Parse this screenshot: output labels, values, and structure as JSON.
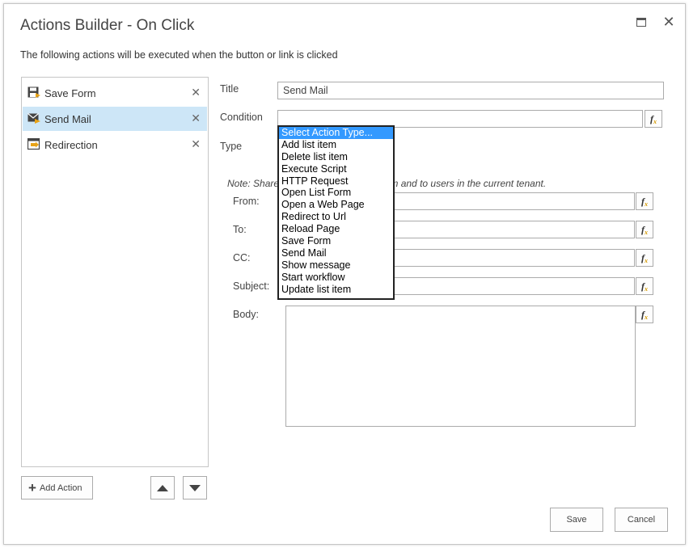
{
  "dialog": {
    "title": "Actions Builder - On Click",
    "subtitle": "The following actions will be executed when the button or link is clicked",
    "close_glyph": "✕"
  },
  "actions": [
    {
      "label": "Save Form",
      "icon": "save-form-icon",
      "selected": false
    },
    {
      "label": "Send Mail",
      "icon": "send-mail-icon",
      "selected": true
    },
    {
      "label": "Redirection",
      "icon": "redirection-icon",
      "selected": false
    }
  ],
  "remove_glyph": "✕",
  "add_action_label": "Add Action",
  "form": {
    "title_label": "Title",
    "title_value": "Send Mail",
    "condition_label": "Condition",
    "condition_value": "",
    "type_label": "Type",
    "note_left": "Note: Share",
    "note_right": "r from and to users in the current tenant.",
    "from_label": "From:",
    "to_label": "To:",
    "cc_label": "CC:",
    "subject_label": "Subject:",
    "body_label": "Body:",
    "fx_glyph": "f",
    "fx_sub": "x"
  },
  "dropdown": {
    "options": [
      "Select Action Type...",
      "Add list item",
      "Delete list item",
      "Execute Script",
      "HTTP Request",
      "Open List Form",
      "Open a Web Page",
      "Redirect to Url",
      "Reload Page",
      "Save Form",
      "Send Mail",
      "Show message",
      "Start workflow",
      "Update list item"
    ],
    "highlighted_index": 0
  },
  "footer": {
    "save_label": "Save",
    "cancel_label": "Cancel"
  },
  "colors": {
    "selected_row": "#cde6f7",
    "highlight": "#3399ff",
    "accent_orange": "#e8a317"
  }
}
